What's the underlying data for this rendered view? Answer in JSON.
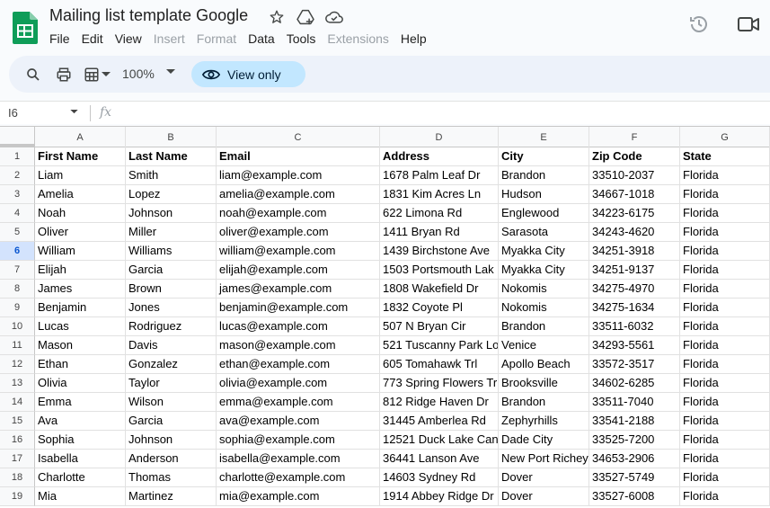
{
  "app": {
    "title": "Mailing list template Google",
    "menu": [
      {
        "label": "File",
        "disabled": false
      },
      {
        "label": "Edit",
        "disabled": false
      },
      {
        "label": "View",
        "disabled": false
      },
      {
        "label": "Insert",
        "disabled": true
      },
      {
        "label": "Format",
        "disabled": true
      },
      {
        "label": "Data",
        "disabled": false
      },
      {
        "label": "Tools",
        "disabled": false
      },
      {
        "label": "Extensions",
        "disabled": true
      },
      {
        "label": "Help",
        "disabled": false
      }
    ]
  },
  "toolbar": {
    "zoom": "100%",
    "view_only_label": "View only"
  },
  "formula_bar": {
    "cell_ref": "I6",
    "fx": "fx"
  },
  "colors": {
    "sheets_green": "#0f9d58",
    "active_row_bg": "#d3e3fd",
    "view_only_bg": "#c2e7ff",
    "disabled_menu": "#9aa0a6"
  },
  "sheet": {
    "column_letters": [
      "A",
      "B",
      "C",
      "D",
      "E",
      "F",
      "G"
    ],
    "row_numbers": [
      "1",
      "2",
      "3",
      "4",
      "5",
      "6",
      "7",
      "8",
      "9",
      "10",
      "11",
      "12",
      "13",
      "14",
      "15",
      "16",
      "17",
      "18",
      "19"
    ],
    "active_row": "6",
    "rows": [
      [
        "First Name",
        "Last Name",
        "Email",
        "Address",
        "City",
        "Zip Code",
        "State"
      ],
      [
        "Liam",
        "Smith",
        "liam@example.com",
        "1678 Palm Leaf Dr",
        "Brandon",
        "33510-2037",
        "Florida"
      ],
      [
        "Amelia",
        "Lopez",
        "amelia@example.com",
        "1831 Kim Acres Ln",
        "Hudson",
        "34667-1018",
        "Florida"
      ],
      [
        "Noah",
        "Johnson",
        "noah@example.com",
        "622 Limona Rd",
        "Englewood",
        "34223-6175",
        "Florida"
      ],
      [
        "Oliver",
        "Miller",
        "oliver@example.com",
        "1411 Bryan Rd",
        "Sarasota",
        "34243-4620",
        "Florida"
      ],
      [
        "William",
        "Williams",
        "william@example.com",
        "1439 Birchstone Ave",
        "Myakka City",
        "34251-3918",
        "Florida"
      ],
      [
        "Elijah",
        "Garcia",
        "elijah@example.com",
        "1503 Portsmouth Lak",
        "Myakka City",
        "34251-9137",
        "Florida"
      ],
      [
        "James",
        "Brown",
        "james@example.com",
        "1808 Wakefield Dr",
        "Nokomis",
        "34275-4970",
        "Florida"
      ],
      [
        "Benjamin",
        "Jones",
        "benjamin@example.com",
        "1832 Coyote Pl",
        "Nokomis",
        "34275-1634",
        "Florida"
      ],
      [
        "Lucas",
        "Rodriguez",
        "lucas@example.com",
        "507 N Bryan Cir",
        "Brandon",
        "33511-6032",
        "Florida"
      ],
      [
        "Mason",
        "Davis",
        "mason@example.com",
        "521 Tuscanny Park Lo",
        "Venice",
        "34293-5561",
        "Florida"
      ],
      [
        "Ethan",
        "Gonzalez",
        "ethan@example.com",
        "605 Tomahawk Trl",
        "Apollo Beach",
        "33572-3517",
        "Florida"
      ],
      [
        "Olivia",
        "Taylor",
        "olivia@example.com",
        "773 Spring Flowers Tr",
        "Brooksville",
        "34602-6285",
        "Florida"
      ],
      [
        "Emma",
        "Wilson",
        "emma@example.com",
        "812 Ridge Haven Dr",
        "Brandon",
        "33511-7040",
        "Florida"
      ],
      [
        "Ava",
        "Garcia",
        "ava@example.com",
        "31445 Amberlea Rd",
        "Zephyrhills",
        "33541-2188",
        "Florida"
      ],
      [
        "Sophia",
        "Johnson",
        "sophia@example.com",
        "12521 Duck Lake Can",
        "Dade City",
        "33525-7200",
        "Florida"
      ],
      [
        "Isabella",
        "Anderson",
        "isabella@example.com",
        "36441 Lanson Ave",
        "New Port Richey",
        "34653-2906",
        "Florida"
      ],
      [
        "Charlotte",
        "Thomas",
        "charlotte@example.com",
        "14603 Sydney Rd",
        "Dover",
        "33527-5749",
        "Florida"
      ],
      [
        "Mia",
        "Martinez",
        "mia@example.com",
        "1914 Abbey Ridge Dr",
        "Dover",
        "33527-6008",
        "Florida"
      ]
    ]
  }
}
